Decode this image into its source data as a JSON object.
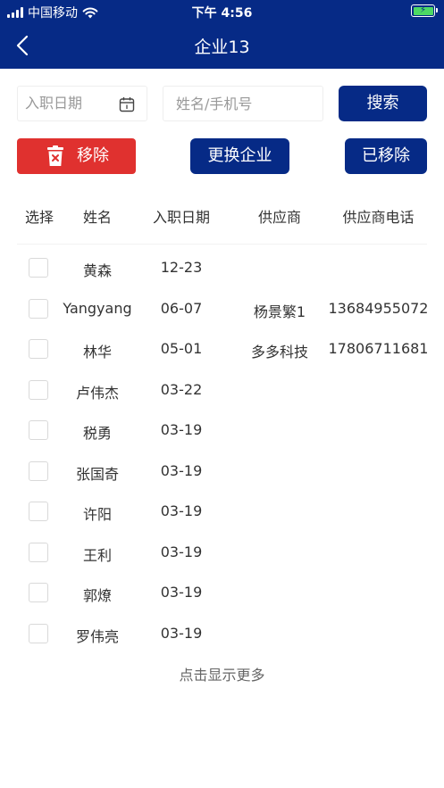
{
  "status": {
    "carrier": "中国移动",
    "time": "下午 4:56"
  },
  "nav": {
    "title": "企业13"
  },
  "filters": {
    "date_placeholder": "入职日期",
    "name_placeholder": "姓名/手机号",
    "search_label": "搜索"
  },
  "actions": {
    "remove_label": "移除",
    "change_label": "更换企业",
    "removed_label": "已移除"
  },
  "table": {
    "headers": [
      "选择",
      "姓名",
      "入职日期",
      "供应商",
      "供应商电话"
    ],
    "rows": [
      {
        "name": "黄森",
        "date": "12-23",
        "supplier": "",
        "phone": ""
      },
      {
        "name": "Yangyang",
        "date": "06-07",
        "supplier": "杨景繁1",
        "phone": "13684955072"
      },
      {
        "name": "林华",
        "date": "05-01",
        "supplier": "多多科技",
        "phone": "17806711681"
      },
      {
        "name": "卢伟杰",
        "date": "03-22",
        "supplier": "",
        "phone": ""
      },
      {
        "name": "税勇",
        "date": "03-19",
        "supplier": "",
        "phone": ""
      },
      {
        "name": "张国奇",
        "date": "03-19",
        "supplier": "",
        "phone": ""
      },
      {
        "name": "许阳",
        "date": "03-19",
        "supplier": "",
        "phone": ""
      },
      {
        "name": "王利",
        "date": "03-19",
        "supplier": "",
        "phone": ""
      },
      {
        "name": "郭燎",
        "date": "03-19",
        "supplier": "",
        "phone": ""
      },
      {
        "name": "罗伟亮",
        "date": "03-19",
        "supplier": "",
        "phone": ""
      }
    ]
  },
  "footer": {
    "more_label": "点击显示更多"
  },
  "colors": {
    "navy": "#062a86",
    "red": "#e0312f",
    "battery_green": "#4cd964"
  },
  "icons": [
    "signal-icon",
    "wifi-icon",
    "battery-icon",
    "back-arrow-icon",
    "calendar-icon",
    "trash-icon"
  ]
}
